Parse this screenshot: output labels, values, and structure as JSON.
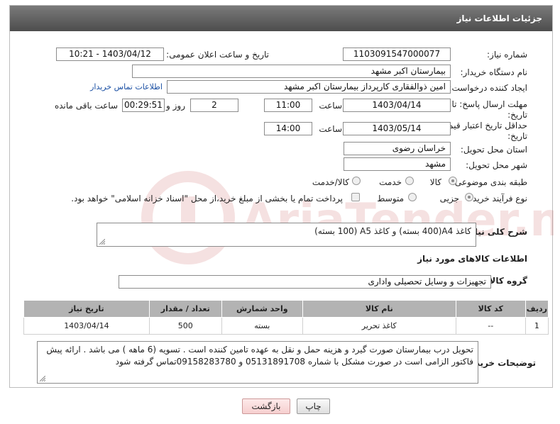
{
  "header": {
    "title": "جزئیات اطلاعات نیاز"
  },
  "fields": {
    "need_number_label": "شماره نیاز:",
    "need_number": "1103091547000077",
    "announce_label": "تاریخ و ساعت اعلان عمومی:",
    "announce_value": "1403/04/12 - 10:21",
    "buyer_org_label": "نام دستگاه خریدار:",
    "buyer_org": "بیمارستان اکبر مشهد",
    "creator_label": "ایجاد کننده درخواست:",
    "creator": "امین ذوالفقاری کارپرداز بیمارستان اکبر مشهد",
    "contact_link": "اطلاعات تماس خریدار",
    "reply_deadline_label": "مهلت ارسال پاسخ: تا تاریخ:",
    "reply_date": "1403/04/14",
    "time_label": "ساعت",
    "reply_time": "11:00",
    "days_value": "2",
    "days_label": "روز و",
    "remaining_time": "00:29:51",
    "remaining_label": "ساعت باقی مانده",
    "price_validity_label": "حداقل تاریخ اعتبار قیمت: تا تاریخ:",
    "validity_date": "1403/05/14",
    "validity_time": "14:00",
    "province_label": "استان محل تحویل:",
    "province": "خراسان رضوی",
    "city_label": "شهر محل تحویل:",
    "city": "مشهد",
    "category_label": "طبقه بندی موضوعی:",
    "category_options": [
      "کالا",
      "خدمت",
      "کالا/خدمت"
    ],
    "process_label": "نوع فرآیند خرید :",
    "process_options": [
      "جزیی",
      "متوسط"
    ],
    "payment_note": "پرداخت تمام یا بخشی از مبلغ خرید،از محل \"اسناد خزانه اسلامی\" خواهد بود."
  },
  "description": {
    "label": "شرح کلی نیاز:",
    "text": "کاغذ A4(400 بسته) و کاغذ A5 (100 بسته)"
  },
  "goods_section": {
    "title": "اطلاعات کالاهای مورد نیاز",
    "group_label": "گروه کالا:",
    "group_value": "تجهیزات و وسایل تحصیلی واداری"
  },
  "table": {
    "headers": [
      "ردیف",
      "کد کالا",
      "نام کالا",
      "واحد شمارش",
      "تعداد / مقدار",
      "تاریخ نیاز"
    ],
    "rows": [
      [
        "1",
        "--",
        "کاغذ تحریر",
        "بسته",
        "500",
        "1403/04/14"
      ]
    ]
  },
  "buyer_notes": {
    "label": "توضیحات خریدار:",
    "text": "تحویل درب بیمارستان صورت گیرد و هزینه حمل و نقل به عهده تامین کننده است . تسویه (6 ماهه ) می باشد . ارائه پیش فاکتور الزامی است در صورت مشکل با شماره 05131891708  و 09158283780تماس گرفته شود"
  },
  "buttons": {
    "print": "چاپ",
    "back": "بازگشت"
  },
  "watermark": {
    "text": "AriaTender.neT"
  },
  "colors": {
    "header_bg": "#5f5f5f",
    "table_header": "#b3b3b3",
    "link": "#1a4fa3",
    "back_button": "#f6cfcf"
  }
}
